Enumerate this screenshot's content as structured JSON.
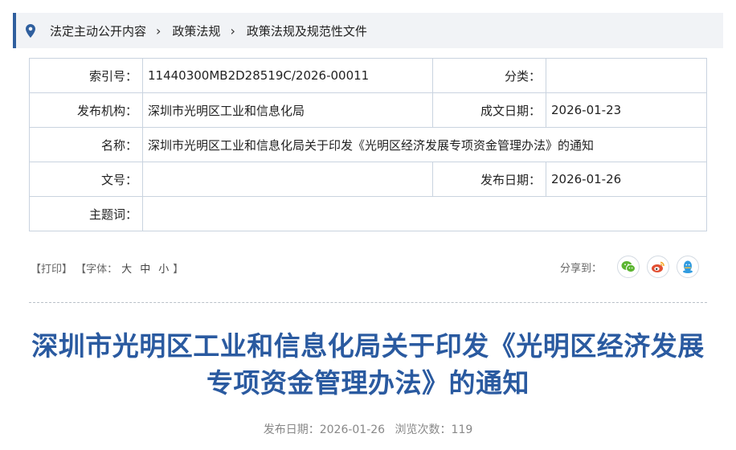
{
  "breadcrumb": [
    "法定主动公开内容",
    "政策法规",
    "政策法规及规范性文件"
  ],
  "info": {
    "index_label": "索引号：",
    "index_value": "11440300MB2D28519C/2026-00011",
    "category_label": "分类：",
    "category_value": "",
    "issuer_label": "发布机构：",
    "issuer_value": "深圳市光明区工业和信息化局",
    "created_label": "成文日期：",
    "created_value": "2026-01-23",
    "name_label": "名称：",
    "name_value": "深圳市光明区工业和信息化局关于印发《光明区经济发展专项资金管理办法》的通知",
    "docno_label": "文号：",
    "docno_value": "",
    "published_label": "发布日期：",
    "published_value": "2026-01-26",
    "topic_label": "主题词：",
    "topic_value": ""
  },
  "tools": {
    "print": "【打印】",
    "font_prefix": "【字体：",
    "large": "大",
    "medium": "中",
    "small": "小",
    "font_suffix": "】"
  },
  "share": {
    "label": "分享到：",
    "icons": [
      "wechat-icon",
      "weibo-icon",
      "qq-icon"
    ]
  },
  "article": {
    "title_line1": "深圳市光明区工业和信息化局关于印发《光明区经济发展",
    "title_line2": "专项资金管理办法》的通知",
    "meta_date": "发布日期：2026-01-26",
    "meta_views": "浏览次数：119"
  },
  "colors": {
    "accent": "#2f5f9e",
    "title": "#2a5aa0",
    "wechat": "#5cb531",
    "weibo": "#e24f32",
    "qq": "#2f9be0"
  }
}
